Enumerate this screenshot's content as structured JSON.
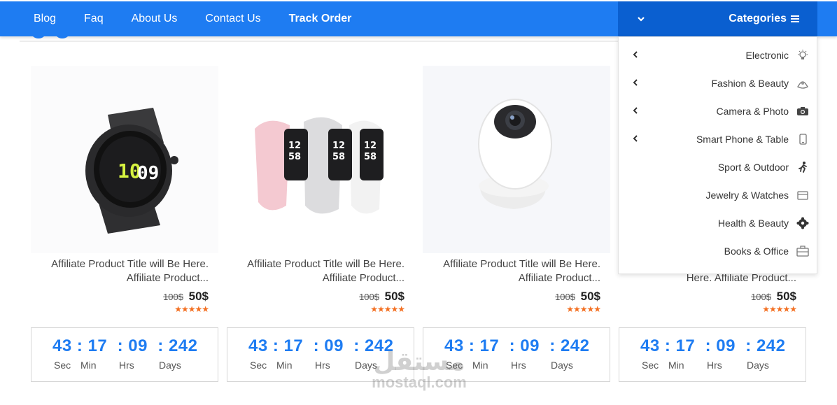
{
  "nav": {
    "links": [
      "Blog",
      "Faq",
      "About Us",
      "Contact Us",
      "Track Order"
    ],
    "categories_label": "Categories"
  },
  "products": [
    {
      "title": "Affiliate Product Title will Be Here. Affiliate Product...",
      "old_price": "100$",
      "new_price": "50$",
      "stars": "★★★★★",
      "image": "smartwatch-image"
    },
    {
      "title": "Affiliate Product Title will Be Here. Affiliate Product...",
      "old_price": "100$",
      "new_price": "50$",
      "stars": "★★★★★",
      "image": "fitness-bands-image"
    },
    {
      "title": "Affiliate Product Title will Be Here. Affiliate Product...",
      "old_price": "100$",
      "new_price": "50$",
      "stars": "★★★★★",
      "image": "security-camera-image"
    },
    {
      "title": "Here. Affiliate Product...",
      "old_price": "100$",
      "new_price": "50$",
      "stars": "★★★★★",
      "image": ""
    }
  ],
  "timer": {
    "values": {
      "sec": "43",
      "min": "17",
      "hrs": "09",
      "days": "242"
    },
    "labels": {
      "sec": "Sec",
      "min": "Min",
      "hrs": "Hrs",
      "days": "Days"
    }
  },
  "categories": [
    {
      "label": "Electronic",
      "icon": "lightbulb-icon",
      "has_sub": true
    },
    {
      "label": "Fashion & Beauty",
      "icon": "hat-icon",
      "has_sub": true
    },
    {
      "label": "Camera & Photo",
      "icon": "camera-icon",
      "has_sub": true
    },
    {
      "label": "Smart Phone & Table",
      "icon": "phone-icon",
      "has_sub": true
    },
    {
      "label": "Sport & Outdoor",
      "icon": "runner-icon",
      "has_sub": false
    },
    {
      "label": "Jewelry & Watches",
      "icon": "jewelry-box-icon",
      "has_sub": false
    },
    {
      "label": "Health & Beauty",
      "icon": "gear-flower-icon",
      "has_sub": false
    },
    {
      "label": "Books & Office",
      "icon": "briefcase-icon",
      "has_sub": false
    }
  ],
  "watermark": {
    "arabic": "مستقل",
    "latin": "mostaql.com"
  },
  "colors": {
    "primary": "#1e7cf2",
    "primary_dark": "#0a5fd0",
    "stars": "#f36f21"
  }
}
